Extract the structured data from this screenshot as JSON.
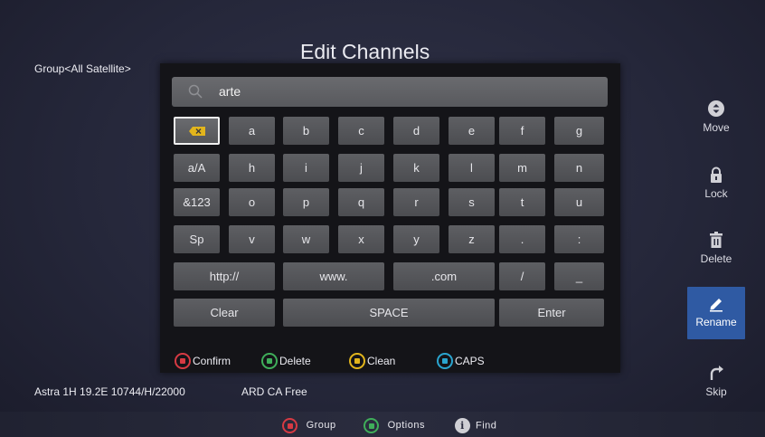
{
  "header": {
    "group": "Group<All Satellite>",
    "title": "Edit Channels"
  },
  "search": {
    "value": "arte"
  },
  "keyboard": {
    "row1": [
      "a",
      "b",
      "c",
      "d",
      "e",
      "f",
      "g"
    ],
    "row2": [
      "a/A",
      "h",
      "i",
      "j",
      "k",
      "l",
      "m",
      "n"
    ],
    "row3": [
      "&123",
      "o",
      "p",
      "q",
      "r",
      "s",
      "t",
      "u"
    ],
    "row4": [
      "Sp",
      "v",
      "w",
      "x",
      "y",
      "z",
      ".",
      ":"
    ],
    "row5": [
      "http://",
      "www.",
      ".com",
      "/",
      "_"
    ],
    "row6": [
      "Clear",
      "SPACE",
      "Enter"
    ]
  },
  "legend": {
    "red": "Confirm",
    "green": "Delete",
    "yellow": "Clean",
    "cyan": "CAPS"
  },
  "side": {
    "move": "Move",
    "lock": "Lock",
    "delete": "Delete",
    "rename": "Rename",
    "skip": "Skip"
  },
  "status": {
    "transponder": "Astra 1H 19.2E  10744/H/22000",
    "channel": "ARD  CA Free"
  },
  "bottom": {
    "red": "Group",
    "green": "Options",
    "info": "Find"
  },
  "colors": {
    "accent": "#2f5aa3",
    "red": "#d63a43",
    "green": "#3fae5a",
    "yellow": "#e2b51c",
    "cyan": "#2aa5cf"
  }
}
